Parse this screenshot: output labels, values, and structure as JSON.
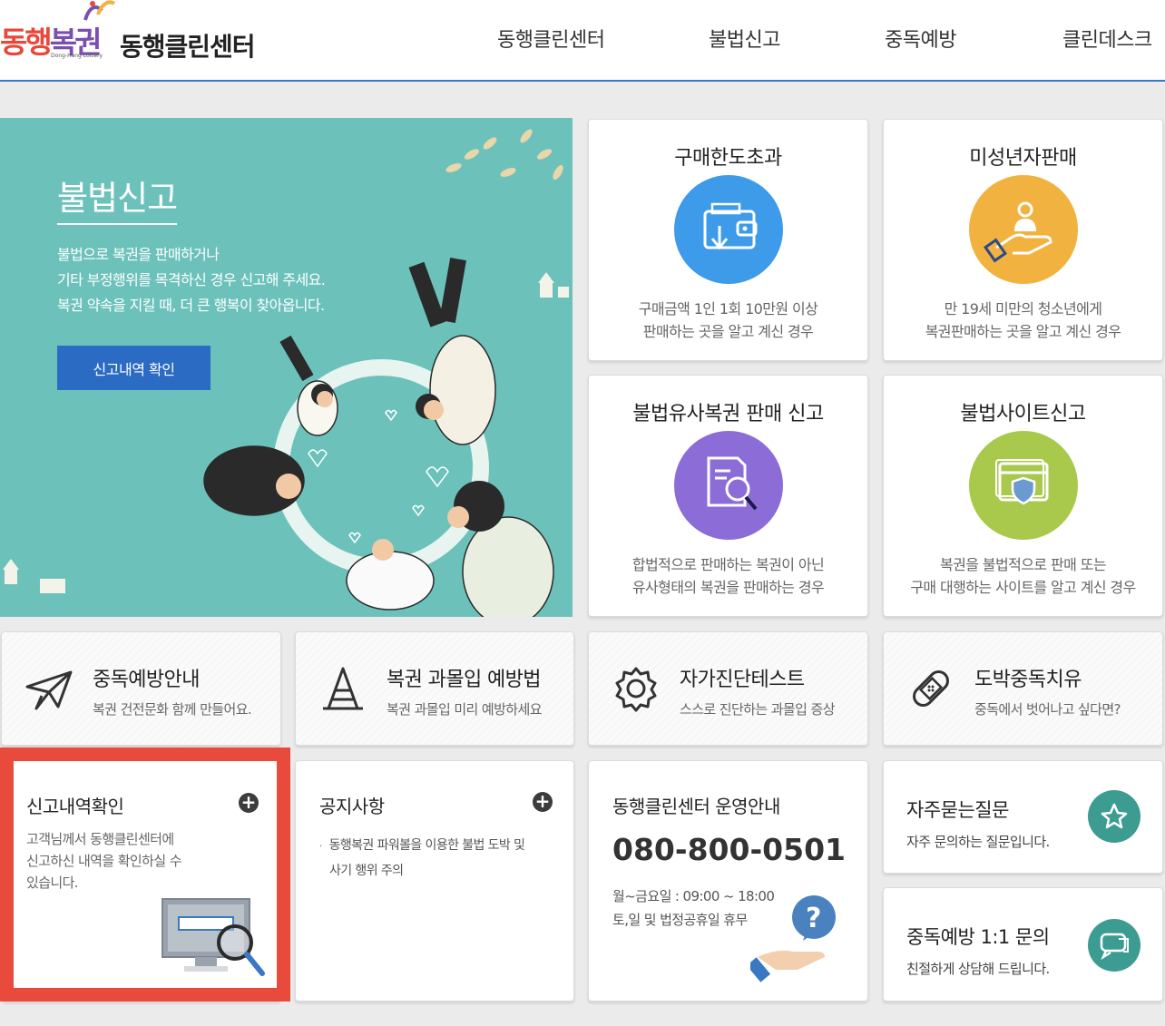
{
  "header": {
    "logo_part1": "동행",
    "logo_part2": "복권",
    "logo_sub": "Dong-Hang Lottery",
    "site_title": "동행클린센터",
    "nav": [
      "동행클린센터",
      "불법신고",
      "중독예방",
      "클린데스크"
    ]
  },
  "hero": {
    "title": "불법신고",
    "desc_line1": "불법으로 복권을 판매하거나",
    "desc_line2": "기타 부정행위를 목격하신 경우 신고해 주세요.",
    "desc_line3": "복권 약속을 지킬 때, 더 큰 행복이 찾아옵니다.",
    "button": "신고내역 확인"
  },
  "report_cards": [
    {
      "title": "구매한도초과",
      "desc1": "구매금액 1인 1회 10만원 이상",
      "desc2": "판매하는 곳을 알고 계신 경우",
      "icon": "wallet-icon",
      "color": "#3d9be9"
    },
    {
      "title": "미성년자판매",
      "desc1": "만 19세 미만의 청소년에게",
      "desc2": "복권판매하는 곳을 알고 계신 경우",
      "icon": "youth-hand-icon",
      "color": "#f2b240"
    },
    {
      "title": "불법유사복권 판매 신고",
      "desc1": "합법적으로 판매하는 복권이 아닌",
      "desc2": "유사형태의 복권을 판매하는 경우",
      "icon": "document-search-icon",
      "color": "#8c6cd6"
    },
    {
      "title": "불법사이트신고",
      "desc1": "복권을 불법적으로 판매 또는",
      "desc2": "구매 대행하는 사이트를 알고 계신 경우",
      "icon": "shield-window-icon",
      "color": "#a9c94c"
    }
  ],
  "guide_cards": [
    {
      "title": "중독예방안내",
      "desc": "복권 건전문화 함께 만들어요.",
      "icon": "paper-plane-icon"
    },
    {
      "title": "복권 과몰입 예방법",
      "desc": "복권 과몰입 미리 예방하세요",
      "icon": "cone-icon"
    },
    {
      "title": "자가진단테스트",
      "desc": "스스로 진단하는 과몰입 증상",
      "icon": "gear-icon"
    },
    {
      "title": "도박중독치유",
      "desc": "중독에서 벗어나고 싶다면?",
      "icon": "bandage-icon"
    }
  ],
  "report_history": {
    "title": "신고내역확인",
    "desc_line1": "고객님께서 동행클린센터에",
    "desc_line2": "신고하신 내역을 확인하실 수",
    "desc_line3": "있습니다."
  },
  "notice": {
    "title": "공지사항",
    "item_line1": "동행복권 파워볼을 이용한 불법 도박 및",
    "item_line2": "사기 행위 주의"
  },
  "operation": {
    "title": "동행클린센터 운영안내",
    "phone": "080-800-0501",
    "hours1": "월~금요일 : 09:00 ~ 18:00",
    "hours2": "토,일 및 법정공휴일 휴무"
  },
  "faq": {
    "title": "자주묻는질문",
    "desc": "자주 문의하는 질문입니다."
  },
  "inquiry": {
    "title": "중독예방 1:1 문의",
    "desc": "친절하게 상담해 드립니다."
  },
  "colors": {
    "accent_blue": "#2c6bc4",
    "hero_teal": "#6cc2bb",
    "highlight_red": "#e84b3c",
    "circle_teal": "#3d9c92"
  }
}
